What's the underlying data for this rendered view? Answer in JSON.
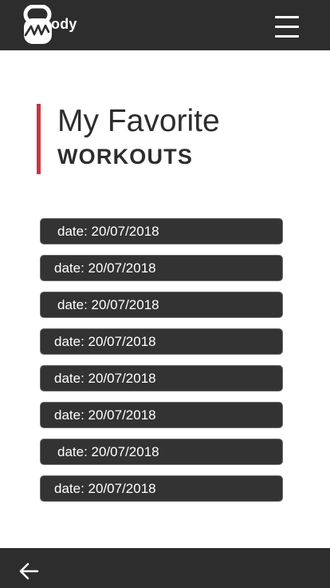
{
  "header": {
    "logo_text": "ody",
    "logo_icon": "kettlebell-icon",
    "menu_icon": "hamburger-menu-icon"
  },
  "page": {
    "title_line1": "My Favorite",
    "title_line2": "WORKOUTS",
    "accent_color": "#c9363e"
  },
  "workouts": [
    {
      "label": "date: 20/07/2018"
    },
    {
      "label": "date: 20/07/2018"
    },
    {
      "label": "date: 20/07/2018"
    },
    {
      "label": "date: 20/07/2018"
    },
    {
      "label": "date: 20/07/2018"
    },
    {
      "label": "date: 20/07/2018"
    },
    {
      "label": "date: 20/07/2018"
    },
    {
      "label": "date: 20/07/2018"
    }
  ],
  "footer": {
    "back_icon": "arrow-left-icon"
  }
}
